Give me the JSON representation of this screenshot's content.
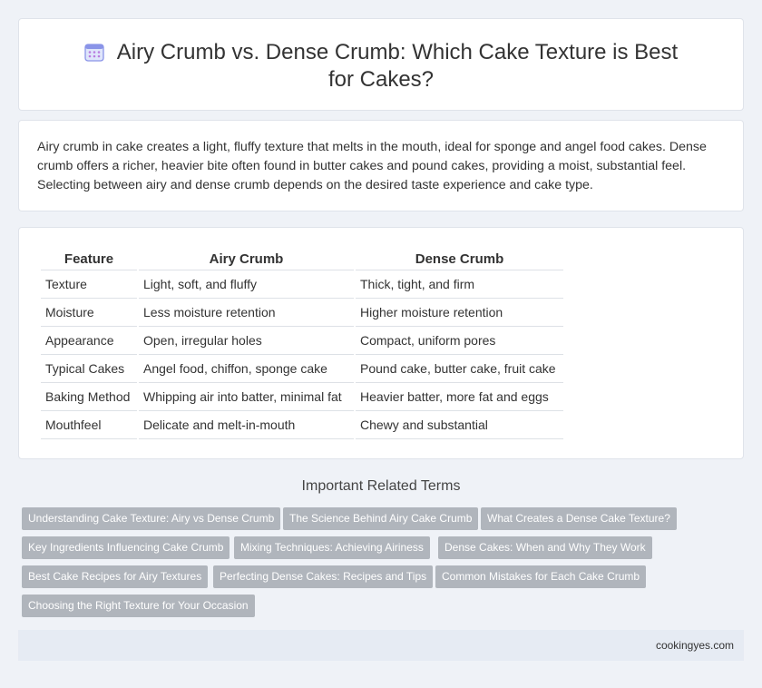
{
  "header": {
    "title": "Airy Crumb vs. Dense Crumb: Which Cake Texture is Best for Cakes?",
    "icon": "calendar-icon"
  },
  "intro": {
    "text": "Airy crumb in cake creates a light, fluffy texture that melts in the mouth, ideal for sponge and angel food cakes. Dense crumb offers a richer, heavier bite often found in butter cakes and pound cakes, providing a moist, substantial feel. Selecting between airy and dense crumb depends on the desired taste experience and cake type."
  },
  "table": {
    "headers": [
      "Feature",
      "Airy Crumb",
      "Dense Crumb"
    ],
    "rows": [
      [
        "Texture",
        "Light, soft, and fluffy",
        "Thick, tight, and firm"
      ],
      [
        "Moisture",
        "Less moisture retention",
        "Higher moisture retention"
      ],
      [
        "Appearance",
        "Open, irregular holes",
        "Compact, uniform pores"
      ],
      [
        "Typical Cakes",
        "Angel food, chiffon, sponge cake",
        "Pound cake, butter cake, fruit cake"
      ],
      [
        "Baking Method",
        "Whipping air into batter, minimal fat",
        "Heavier batter, more fat and eggs"
      ],
      [
        "Mouthfeel",
        "Delicate and melt-in-mouth",
        "Chewy and substantial"
      ]
    ]
  },
  "related": {
    "title": "Important Related Terms",
    "tags": [
      "Understanding Cake Texture: Airy vs Dense Crumb",
      "The Science Behind Airy Cake Crumb",
      "What Creates a Dense Cake Texture?",
      "Key Ingredients Influencing Cake Crumb",
      "Mixing Techniques: Achieving Airiness",
      "Dense Cakes: When and Why They Work",
      "Best Cake Recipes for Airy Textures",
      "Perfecting Dense Cakes: Recipes and Tips",
      "Common Mistakes for Each Cake Crumb",
      "Choosing the Right Texture for Your Occasion"
    ]
  },
  "footer": {
    "site": "cookingyes.com"
  }
}
